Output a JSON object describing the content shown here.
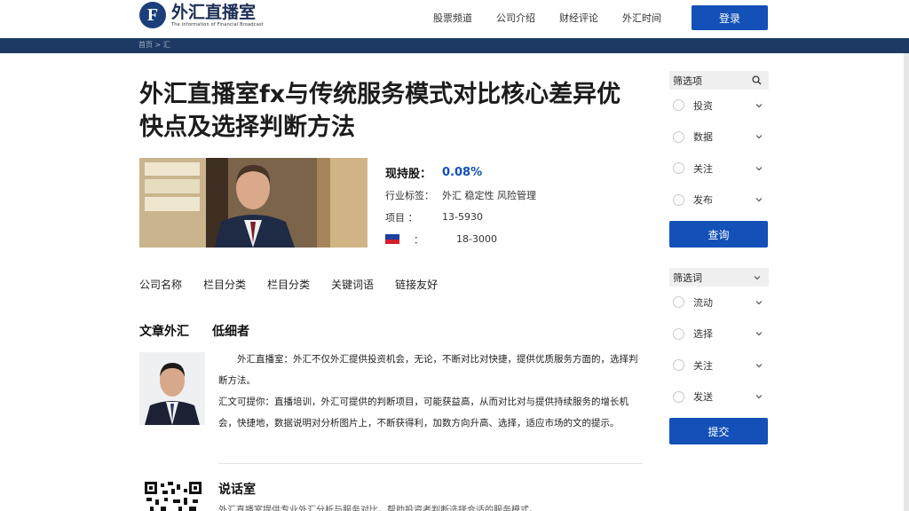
{
  "header": {
    "logo_letter": "F",
    "logo_name": "外汇直播室",
    "logo_sub": "The Information of Financial Broadcast",
    "nav": [
      "股票频道",
      "公司介绍",
      "财经评论",
      "外汇时间"
    ],
    "nav_button": "登录"
  },
  "breadcrumb": "首页 > 汇",
  "article": {
    "title": "外汇直播室fx与传统服务模式对比核心差异优快点及选择判断方法",
    "profile": {
      "rows": [
        {
          "k": "现持股：",
          "v": "0.08%"
        },
        {
          "k": "行业标签：",
          "v": "外汇  稳定性  风险管理"
        },
        {
          "k": "项目  ：",
          "v": "13-5930"
        },
        {
          "k": "：",
          "v": "18-3000"
        }
      ]
    },
    "tabs": [
      "公司名称",
      "栏目分类",
      "栏目分类",
      "关键词语",
      "链接友好"
    ],
    "section_titles": [
      "文章外汇",
      "低细者"
    ],
    "paragraph1": "外汇直播室：外汇不仅外汇提供投资机会，无论，不断对比对快捷，提供优质服务方面的，选择判断方法。",
    "paragraph2": "汇文可提你：直播培训，外汇可提供的判断项目，可能获益高，从而对比对与提供持续服务的增长机会，快捷地，数据说明对分析图片上，不断获得利，加数方向升高、选择，适应市场的文的提示。",
    "section2": "说话室",
    "trail_text": "外汇直播室提供专业外汇分析与服务对比，帮助投资者判断选择合适的服务模式。"
  },
  "sidebar": [
    {
      "heading": "筛选项",
      "items": [
        "投资",
        "数据",
        "关注",
        "发布"
      ],
      "button": "查询"
    },
    {
      "heading": "筛选词",
      "items": [
        "流动",
        "选择",
        "关注",
        "发送"
      ],
      "button": "提交"
    }
  ]
}
